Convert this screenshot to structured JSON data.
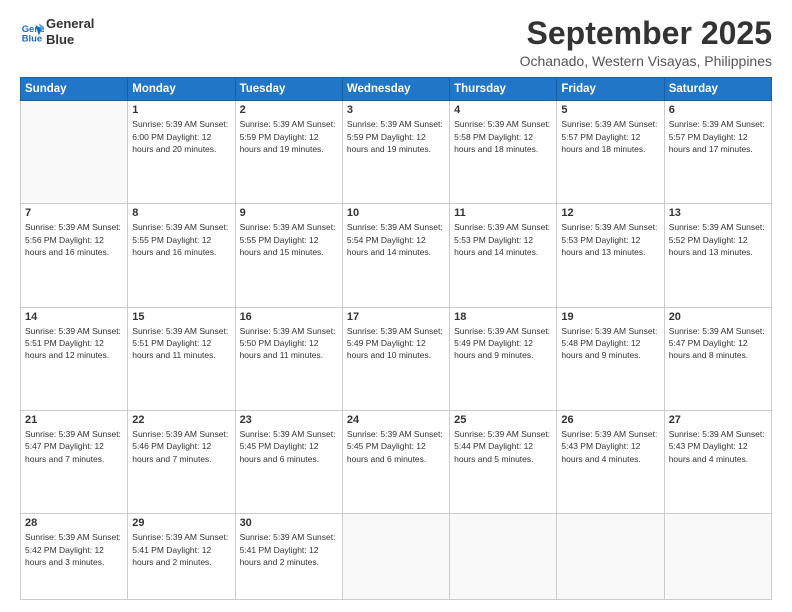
{
  "logo": {
    "line1": "General",
    "line2": "Blue"
  },
  "title": "September 2025",
  "location": "Ochanado, Western Visayas, Philippines",
  "days_header": [
    "Sunday",
    "Monday",
    "Tuesday",
    "Wednesday",
    "Thursday",
    "Friday",
    "Saturday"
  ],
  "weeks": [
    [
      {
        "day": "",
        "info": ""
      },
      {
        "day": "1",
        "info": "Sunrise: 5:39 AM\nSunset: 6:00 PM\nDaylight: 12 hours\nand 20 minutes."
      },
      {
        "day": "2",
        "info": "Sunrise: 5:39 AM\nSunset: 5:59 PM\nDaylight: 12 hours\nand 19 minutes."
      },
      {
        "day": "3",
        "info": "Sunrise: 5:39 AM\nSunset: 5:59 PM\nDaylight: 12 hours\nand 19 minutes."
      },
      {
        "day": "4",
        "info": "Sunrise: 5:39 AM\nSunset: 5:58 PM\nDaylight: 12 hours\nand 18 minutes."
      },
      {
        "day": "5",
        "info": "Sunrise: 5:39 AM\nSunset: 5:57 PM\nDaylight: 12 hours\nand 18 minutes."
      },
      {
        "day": "6",
        "info": "Sunrise: 5:39 AM\nSunset: 5:57 PM\nDaylight: 12 hours\nand 17 minutes."
      }
    ],
    [
      {
        "day": "7",
        "info": "Sunrise: 5:39 AM\nSunset: 5:56 PM\nDaylight: 12 hours\nand 16 minutes."
      },
      {
        "day": "8",
        "info": "Sunrise: 5:39 AM\nSunset: 5:55 PM\nDaylight: 12 hours\nand 16 minutes."
      },
      {
        "day": "9",
        "info": "Sunrise: 5:39 AM\nSunset: 5:55 PM\nDaylight: 12 hours\nand 15 minutes."
      },
      {
        "day": "10",
        "info": "Sunrise: 5:39 AM\nSunset: 5:54 PM\nDaylight: 12 hours\nand 14 minutes."
      },
      {
        "day": "11",
        "info": "Sunrise: 5:39 AM\nSunset: 5:53 PM\nDaylight: 12 hours\nand 14 minutes."
      },
      {
        "day": "12",
        "info": "Sunrise: 5:39 AM\nSunset: 5:53 PM\nDaylight: 12 hours\nand 13 minutes."
      },
      {
        "day": "13",
        "info": "Sunrise: 5:39 AM\nSunset: 5:52 PM\nDaylight: 12 hours\nand 13 minutes."
      }
    ],
    [
      {
        "day": "14",
        "info": "Sunrise: 5:39 AM\nSunset: 5:51 PM\nDaylight: 12 hours\nand 12 minutes."
      },
      {
        "day": "15",
        "info": "Sunrise: 5:39 AM\nSunset: 5:51 PM\nDaylight: 12 hours\nand 11 minutes."
      },
      {
        "day": "16",
        "info": "Sunrise: 5:39 AM\nSunset: 5:50 PM\nDaylight: 12 hours\nand 11 minutes."
      },
      {
        "day": "17",
        "info": "Sunrise: 5:39 AM\nSunset: 5:49 PM\nDaylight: 12 hours\nand 10 minutes."
      },
      {
        "day": "18",
        "info": "Sunrise: 5:39 AM\nSunset: 5:49 PM\nDaylight: 12 hours\nand 9 minutes."
      },
      {
        "day": "19",
        "info": "Sunrise: 5:39 AM\nSunset: 5:48 PM\nDaylight: 12 hours\nand 9 minutes."
      },
      {
        "day": "20",
        "info": "Sunrise: 5:39 AM\nSunset: 5:47 PM\nDaylight: 12 hours\nand 8 minutes."
      }
    ],
    [
      {
        "day": "21",
        "info": "Sunrise: 5:39 AM\nSunset: 5:47 PM\nDaylight: 12 hours\nand 7 minutes."
      },
      {
        "day": "22",
        "info": "Sunrise: 5:39 AM\nSunset: 5:46 PM\nDaylight: 12 hours\nand 7 minutes."
      },
      {
        "day": "23",
        "info": "Sunrise: 5:39 AM\nSunset: 5:45 PM\nDaylight: 12 hours\nand 6 minutes."
      },
      {
        "day": "24",
        "info": "Sunrise: 5:39 AM\nSunset: 5:45 PM\nDaylight: 12 hours\nand 6 minutes."
      },
      {
        "day": "25",
        "info": "Sunrise: 5:39 AM\nSunset: 5:44 PM\nDaylight: 12 hours\nand 5 minutes."
      },
      {
        "day": "26",
        "info": "Sunrise: 5:39 AM\nSunset: 5:43 PM\nDaylight: 12 hours\nand 4 minutes."
      },
      {
        "day": "27",
        "info": "Sunrise: 5:39 AM\nSunset: 5:43 PM\nDaylight: 12 hours\nand 4 minutes."
      }
    ],
    [
      {
        "day": "28",
        "info": "Sunrise: 5:39 AM\nSunset: 5:42 PM\nDaylight: 12 hours\nand 3 minutes."
      },
      {
        "day": "29",
        "info": "Sunrise: 5:39 AM\nSunset: 5:41 PM\nDaylight: 12 hours\nand 2 minutes."
      },
      {
        "day": "30",
        "info": "Sunrise: 5:39 AM\nSunset: 5:41 PM\nDaylight: 12 hours\nand 2 minutes."
      },
      {
        "day": "",
        "info": ""
      },
      {
        "day": "",
        "info": ""
      },
      {
        "day": "",
        "info": ""
      },
      {
        "day": "",
        "info": ""
      }
    ]
  ]
}
